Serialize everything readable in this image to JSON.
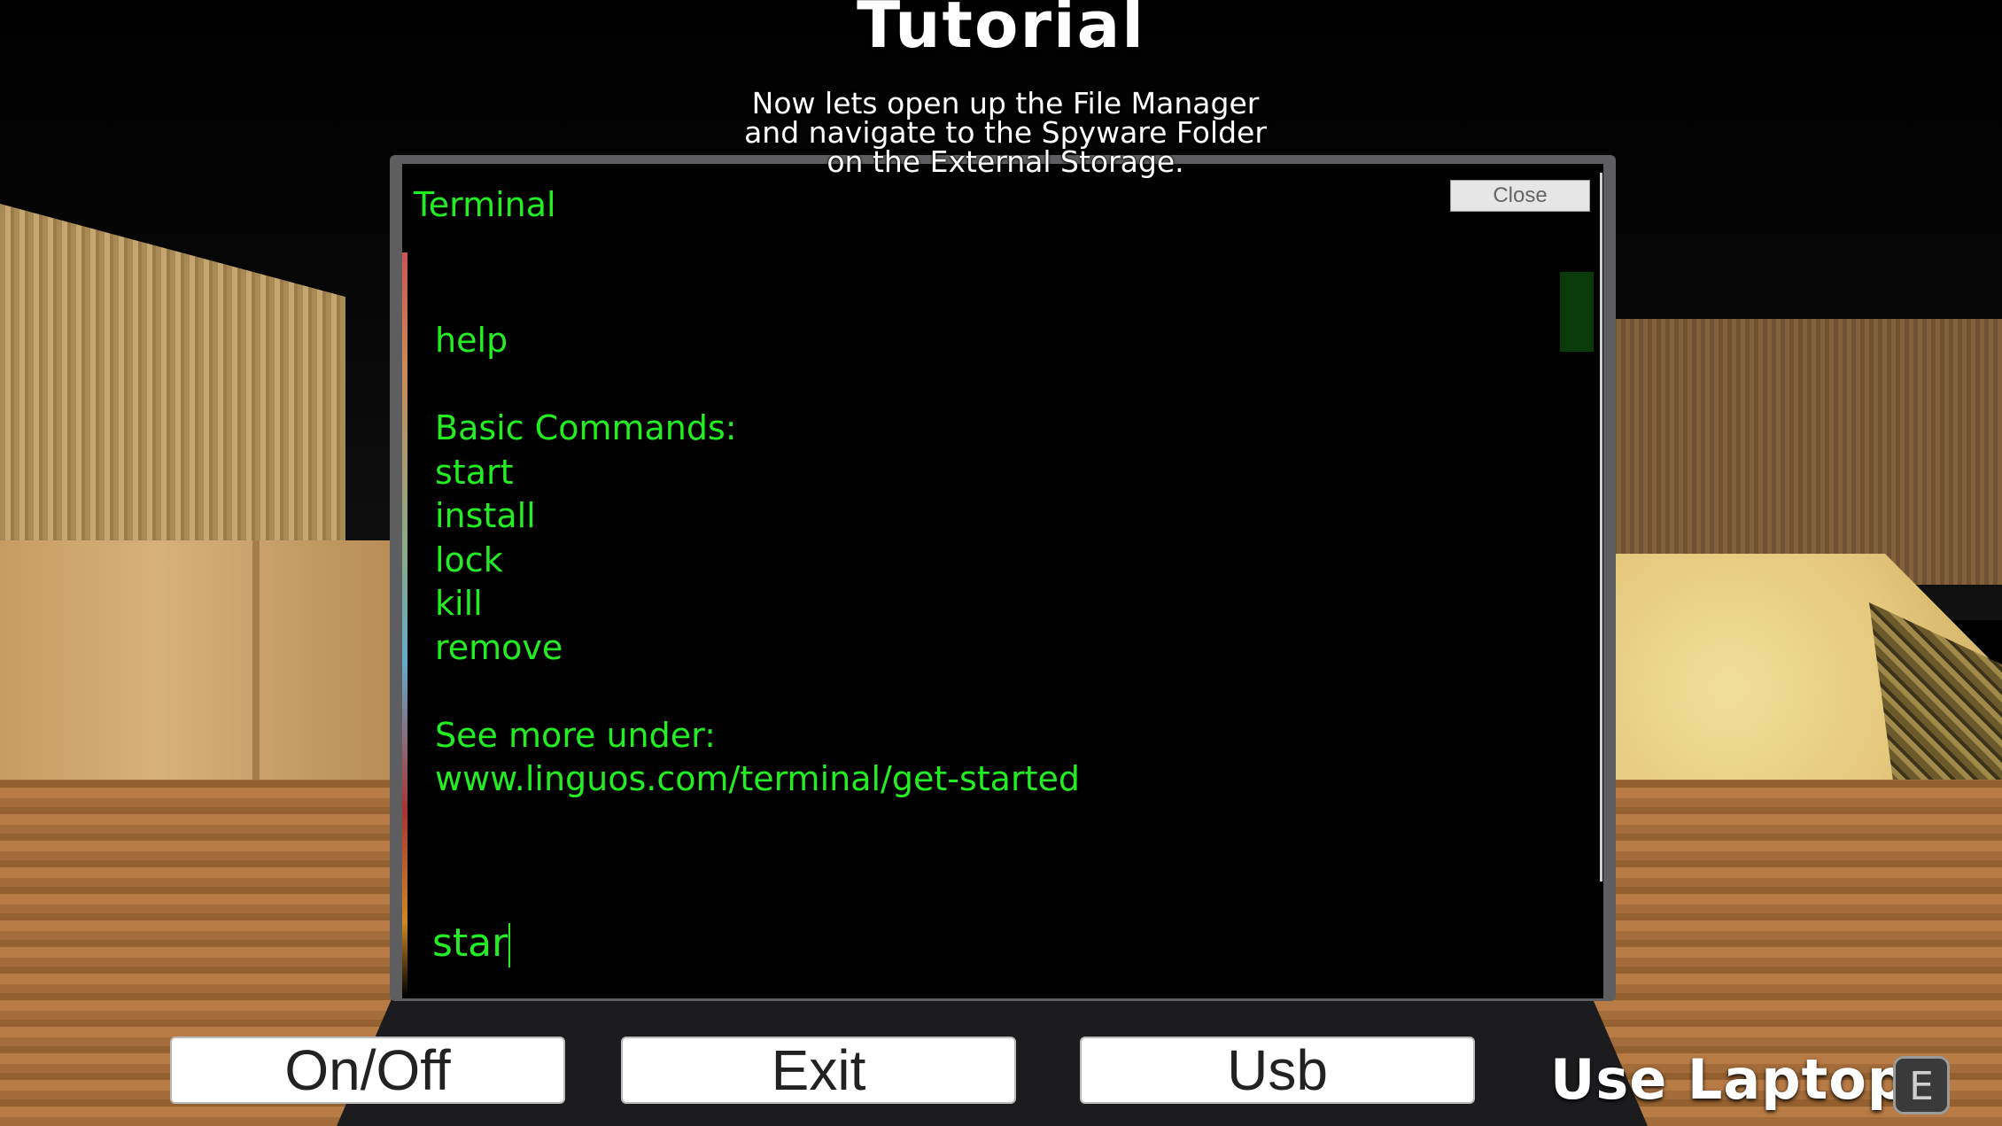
{
  "tutorial": {
    "title": "Tutorial",
    "instruction_lines": [
      "Now lets open up the File Manager",
      "and navigate to the Spyware Folder",
      "on the External Storage."
    ]
  },
  "terminal": {
    "title": "Terminal",
    "close_label": "Close",
    "log": [
      "help",
      "",
      "Basic Commands:",
      "start",
      "install",
      "lock",
      "kill",
      "remove",
      "",
      "See more under:",
      "www.linguos.com/terminal/get-started"
    ],
    "input_value": "star",
    "text_color": "#22ee22"
  },
  "hud": {
    "buttons": [
      "On/Off",
      "Exit",
      "Usb"
    ],
    "use_laptop_label": "Use Laptop",
    "key_hint": "E"
  }
}
